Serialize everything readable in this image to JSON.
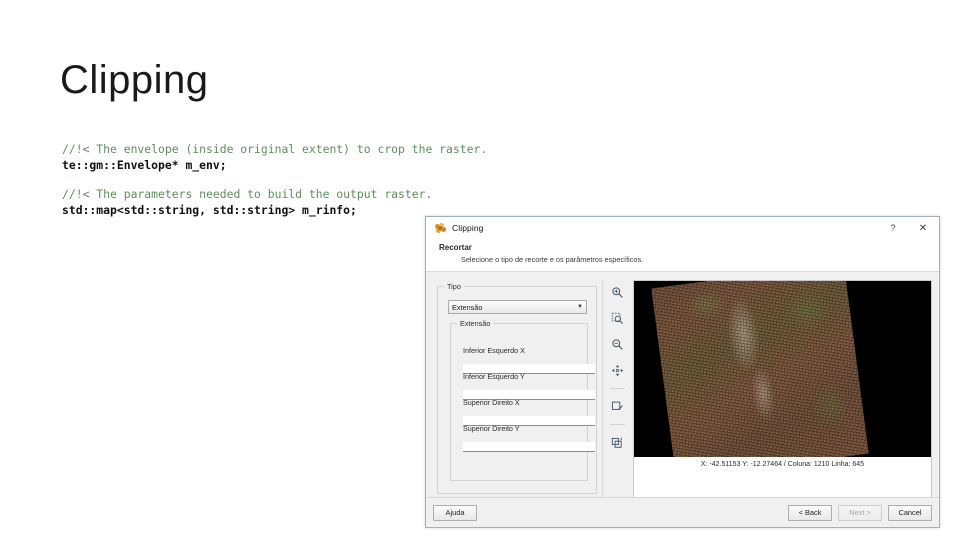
{
  "slide": {
    "title": "Clipping",
    "code": {
      "comment1": "//!< The envelope (inside original extent) to crop the raster.",
      "line1": "te::gm::Envelope* m_env;",
      "comment2": "//!< The parameters needed to build the output raster.",
      "line2": "std::map<std::string, std::string> m_rinfo;",
      "comment_color": "#5f8f5c",
      "code_color": "#111111"
    }
  },
  "dialog": {
    "title": "Clipping",
    "help_button": "?",
    "close_button": "✕",
    "header": {
      "title": "Recortar",
      "subtitle": "Selecione o tipo de recorte e os parâmetros específicos."
    },
    "tipo_group": {
      "legend": "Tipo",
      "combo_value": "Extensão",
      "combo_arrow": "▼"
    },
    "extent_group": {
      "legend": "Extensão",
      "fields": [
        {
          "label": "Inferior Esquerdo X",
          "value": ""
        },
        {
          "label": "Inferior Esquerdo Y",
          "value": ""
        },
        {
          "label": "Superior Direito X",
          "value": ""
        },
        {
          "label": "Superior Direito Y",
          "value": ""
        }
      ]
    },
    "toolbar": [
      {
        "name": "zoom-in-icon",
        "title": "Zoom In"
      },
      {
        "name": "zoom-area-icon",
        "title": "Zoom Area"
      },
      {
        "name": "zoom-out-icon",
        "title": "Zoom Out"
      },
      {
        "name": "pan-icon",
        "title": "Pan"
      },
      {
        "name": "draw-extent-icon",
        "title": "Desenhar Extensão"
      },
      {
        "name": "layer-info-icon",
        "title": "Informações"
      }
    ],
    "status": {
      "text": "X: -42.51153   Y: -12.27464  / Coluna: 1210   Linha: 645"
    },
    "footer": {
      "help": "Ajuda",
      "back": "< Back",
      "next": "Next >",
      "cancel": "Cancel"
    },
    "colors": {
      "border": "#9ab2c4",
      "body": "#f0f0f0",
      "titlebar": "#ffffff"
    }
  }
}
